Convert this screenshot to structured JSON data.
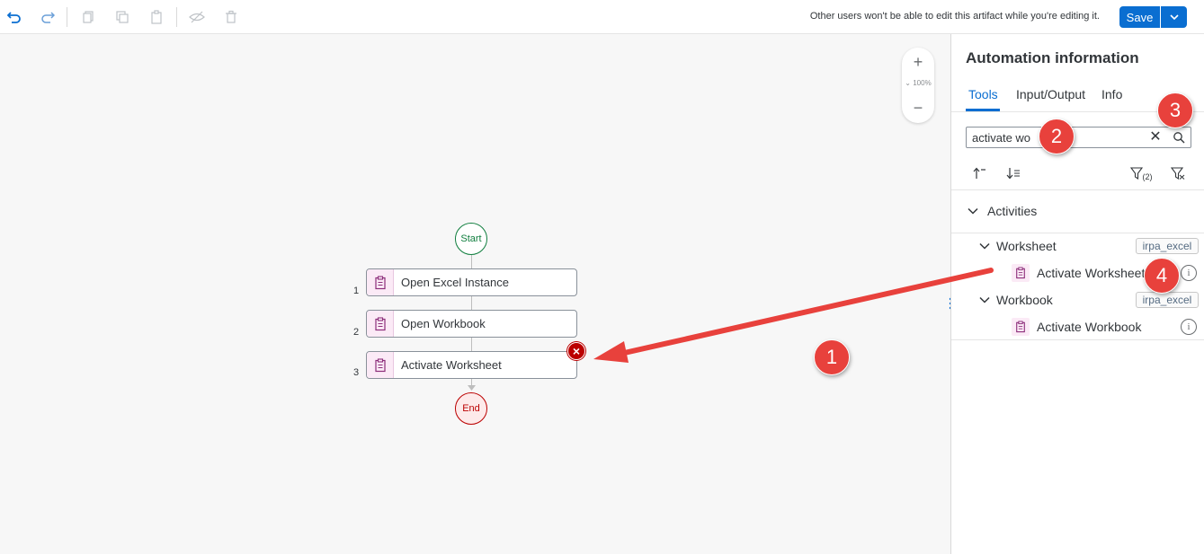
{
  "toolbar": {
    "undo_icon": "undo-icon",
    "redo_icon": "redo-icon",
    "notice": "Other users won't be able to edit this artifact while you're editing it.",
    "save_label": "Save"
  },
  "canvas": {
    "zoom_level": "100%",
    "zoom_plus": "+",
    "zoom_minus": "−",
    "start_label": "Start",
    "end_label": "End",
    "steps": [
      {
        "num": "1",
        "label": "Open Excel Instance"
      },
      {
        "num": "2",
        "label": "Open Workbook"
      },
      {
        "num": "3",
        "label": "Activate Worksheet",
        "has_error": true
      }
    ]
  },
  "panel": {
    "title": "Automation information",
    "tabs": [
      {
        "label": "Tools",
        "active": true
      },
      {
        "label": "Input/Output",
        "active": false
      },
      {
        "label": "Info",
        "active": false
      }
    ],
    "search": {
      "value": "activate wo"
    },
    "filter_count": "(2)",
    "activities_label": "Activities",
    "groups": [
      {
        "label": "Worksheet",
        "lib": "irpa_excel",
        "item": "Activate Worksheet"
      },
      {
        "label": "Workbook",
        "lib": "irpa_excel",
        "item": "Activate Workbook"
      }
    ]
  },
  "annotations": {
    "callouts": [
      "1",
      "2",
      "3",
      "4"
    ],
    "color": "#e8413c"
  },
  "colors": {
    "accent": "#0a6ed1",
    "start": "#107e3e",
    "end": "#bb0000",
    "activity_icon_bg": "#fbeaf6"
  }
}
